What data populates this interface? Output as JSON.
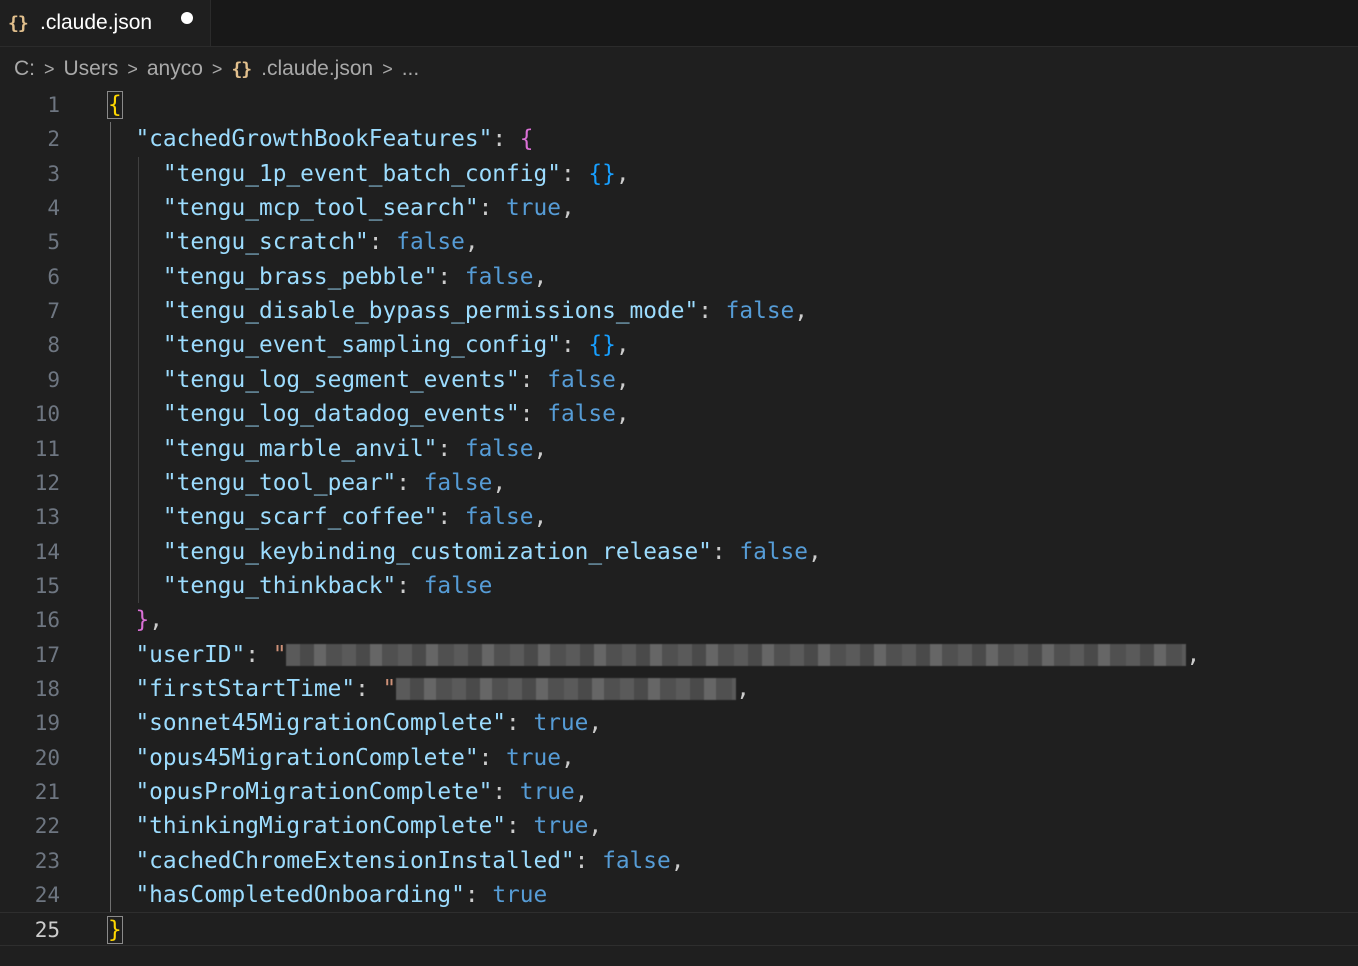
{
  "tab": {
    "icon": "{}",
    "label": ".claude.json",
    "dirty": true
  },
  "breadcrumb": {
    "items": [
      "C:",
      "Users",
      "anyco",
      ".claude.json",
      "..."
    ],
    "separator": ">",
    "json_icon": "{}"
  },
  "editor": {
    "active_line": 25,
    "lines": [
      {
        "n": "1"
      },
      {
        "n": "2",
        "key": "\"cachedGrowthBookFeatures\"",
        "val": "{",
        "kind": "open"
      },
      {
        "n": "3",
        "key": "\"tengu_1p_event_batch_config\"",
        "val": "{}",
        "kind": "obj",
        "comma": ","
      },
      {
        "n": "4",
        "key": "\"tengu_mcp_tool_search\"",
        "val": "true",
        "kind": "bool",
        "comma": ","
      },
      {
        "n": "5",
        "key": "\"tengu_scratch\"",
        "val": "false",
        "kind": "bool",
        "comma": ","
      },
      {
        "n": "6",
        "key": "\"tengu_brass_pebble\"",
        "val": "false",
        "kind": "bool",
        "comma": ","
      },
      {
        "n": "7",
        "key": "\"tengu_disable_bypass_permissions_mode\"",
        "val": "false",
        "kind": "bool",
        "comma": ","
      },
      {
        "n": "8",
        "key": "\"tengu_event_sampling_config\"",
        "val": "{}",
        "kind": "obj",
        "comma": ","
      },
      {
        "n": "9",
        "key": "\"tengu_log_segment_events\"",
        "val": "false",
        "kind": "bool",
        "comma": ","
      },
      {
        "n": "10",
        "key": "\"tengu_log_datadog_events\"",
        "val": "false",
        "kind": "bool",
        "comma": ","
      },
      {
        "n": "11",
        "key": "\"tengu_marble_anvil\"",
        "val": "false",
        "kind": "bool",
        "comma": ","
      },
      {
        "n": "12",
        "key": "\"tengu_tool_pear\"",
        "val": "false",
        "kind": "bool",
        "comma": ","
      },
      {
        "n": "13",
        "key": "\"tengu_scarf_coffee\"",
        "val": "false",
        "kind": "bool",
        "comma": ","
      },
      {
        "n": "14",
        "key": "\"tengu_keybinding_customization_release\"",
        "val": "false",
        "kind": "bool",
        "comma": ","
      },
      {
        "n": "15",
        "key": "\"tengu_thinkback\"",
        "val": "false",
        "kind": "bool",
        "comma": ""
      },
      {
        "n": "16",
        "val": "}",
        "kind": "close",
        "comma": ","
      },
      {
        "n": "17",
        "key": "\"userID\"",
        "val": "\"",
        "kind": "redacted",
        "comma": ","
      },
      {
        "n": "18",
        "key": "\"firstStartTime\"",
        "val": "\"",
        "kind": "redacted",
        "comma": ","
      },
      {
        "n": "19",
        "key": "\"sonnet45MigrationComplete\"",
        "val": "true",
        "kind": "bool",
        "comma": ","
      },
      {
        "n": "20",
        "key": "\"opus45MigrationComplete\"",
        "val": "true",
        "kind": "bool",
        "comma": ","
      },
      {
        "n": "21",
        "key": "\"opusProMigrationComplete\"",
        "val": "true",
        "kind": "bool",
        "comma": ","
      },
      {
        "n": "22",
        "key": "\"thinkingMigrationComplete\"",
        "val": "true",
        "kind": "bool",
        "comma": ","
      },
      {
        "n": "23",
        "key": "\"cachedChromeExtensionInstalled\"",
        "val": "false",
        "kind": "bool",
        "comma": ","
      },
      {
        "n": "24",
        "key": "\"hasCompletedOnboarding\"",
        "val": "true",
        "kind": "bool",
        "comma": ""
      },
      {
        "n": "25"
      }
    ],
    "root_open": "{",
    "root_close": "}"
  }
}
